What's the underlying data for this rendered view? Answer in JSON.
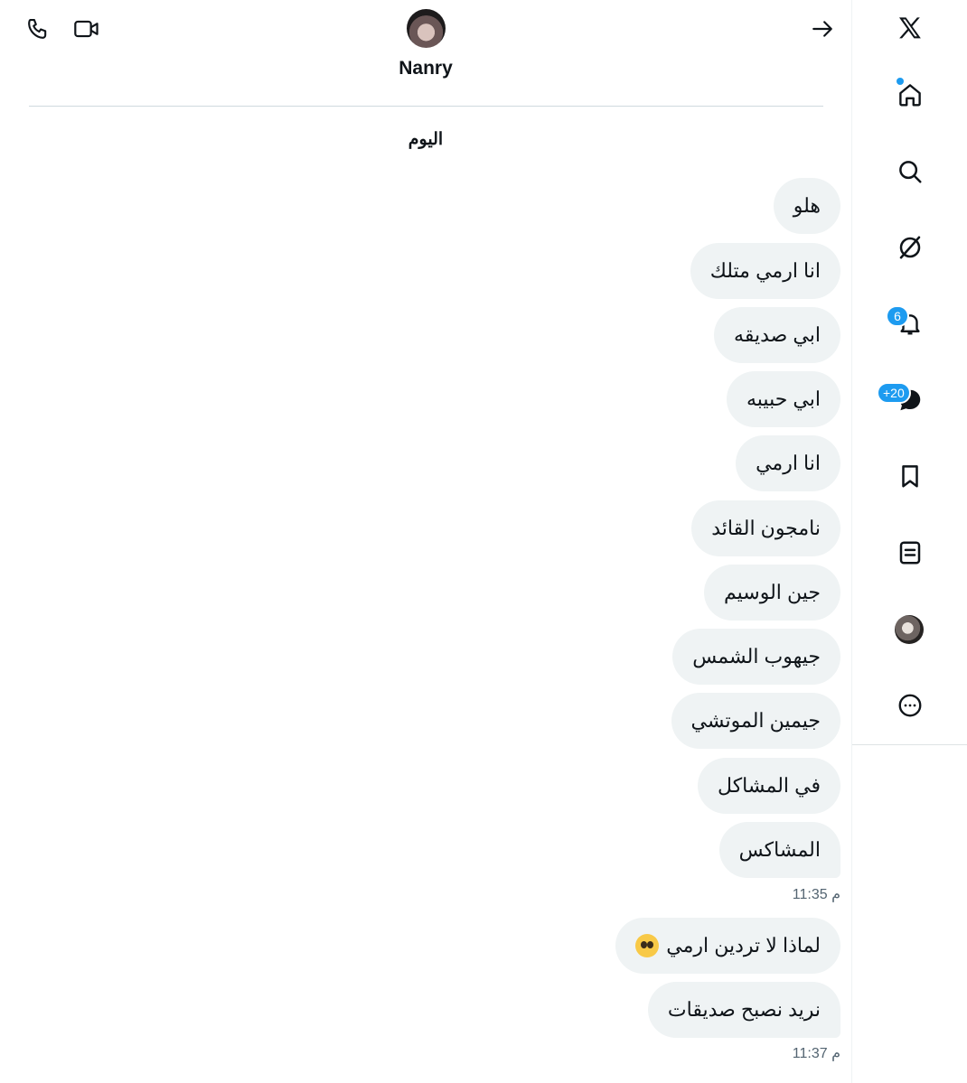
{
  "header": {
    "contact_name": "Nanry",
    "icons": [
      "phone-icon",
      "video-icon",
      "back-arrow-icon"
    ]
  },
  "conversation": {
    "day_label": "اليوم",
    "messages": [
      {
        "text": "هلو"
      },
      {
        "text": "انا ارمي متلك"
      },
      {
        "text": "ابي صديقه"
      },
      {
        "text": "ابي حبيبه"
      },
      {
        "text": "انا ارمي"
      },
      {
        "text": "نامجون القائد"
      },
      {
        "text": "جين الوسيم"
      },
      {
        "text": "جيهوب الشمس"
      },
      {
        "text": "جيمين الموتشي"
      },
      {
        "text": "في المشاكل"
      },
      {
        "text": "المشاكس"
      },
      {
        "text": "لماذا لا تردين ارمي",
        "emoji": "pleading-face-emoji"
      },
      {
        "text": "نريد نصبح صديقات"
      }
    ],
    "timestamps": [
      "11:35 م",
      "11:37 م"
    ]
  },
  "nav": {
    "items": [
      "x-logo-icon",
      "home-icon",
      "search-icon",
      "grok-icon",
      "notifications-icon",
      "messages-icon",
      "bookmarks-icon",
      "lists-icon",
      "profile-avatar",
      "more-icon"
    ],
    "notifications_badge": "6",
    "messages_badge": "+20"
  },
  "colors": {
    "accent": "#1d9bf0",
    "bubble": "#eff3f4",
    "text": "#0f1419",
    "muted": "#536471"
  }
}
